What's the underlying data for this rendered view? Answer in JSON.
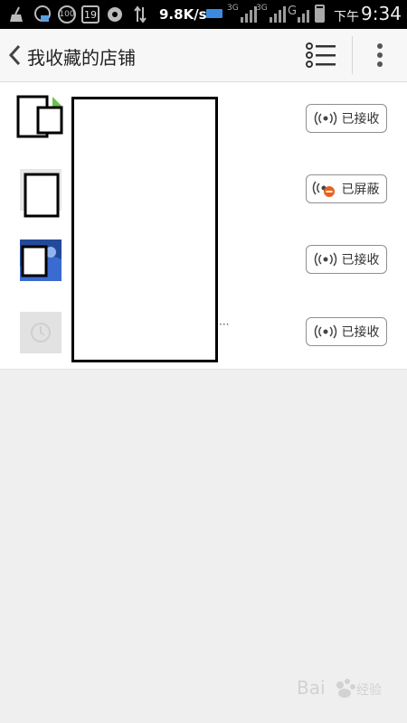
{
  "status_bar": {
    "speed": "9.8K/s",
    "net_type_1": "3G",
    "net_type_2": "3G",
    "net_type_3": "G",
    "time_prefix": "下午",
    "time": "9:34",
    "badge_100": "100",
    "calendar_day": "19"
  },
  "header": {
    "title": "我收藏的店铺"
  },
  "shops": [
    {
      "status_label": "已接收",
      "status": "received"
    },
    {
      "status_label": "已屏蔽",
      "status": "blocked"
    },
    {
      "status_label": "已接收",
      "status": "received"
    },
    {
      "status_label": "已接收",
      "status": "received"
    }
  ],
  "colors": {
    "accent_blocked": "#e8621f",
    "header_bg": "#f7f7f7",
    "page_bg": "#efefef"
  },
  "icons": [
    "back-icon",
    "list-view-icon",
    "more-vert-icon",
    "broadcast-icon",
    "blocked-badge-icon"
  ]
}
